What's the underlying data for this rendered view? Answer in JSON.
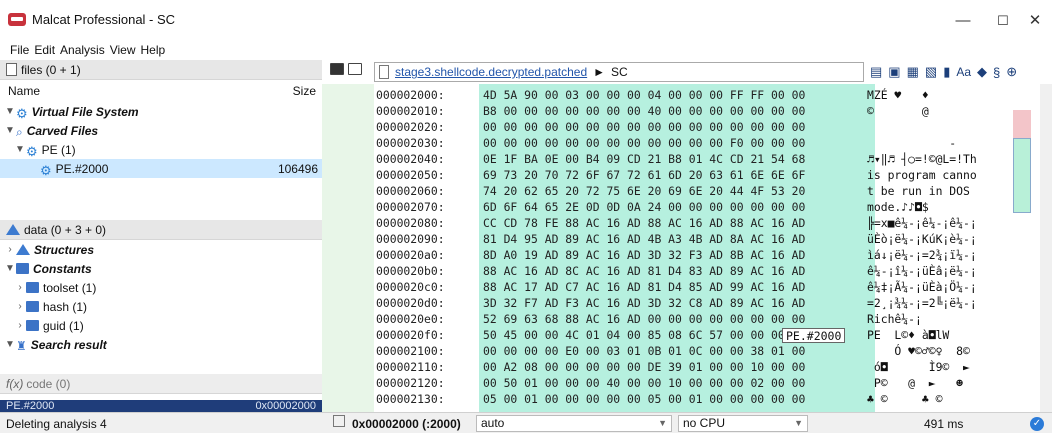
{
  "window": {
    "title": "Malcat Professional - SC",
    "min": "—",
    "max": "☐",
    "close": "✕"
  },
  "menu": [
    "File",
    "Edit",
    "Analysis",
    "View",
    "Help"
  ],
  "files_panel": {
    "header": "files (0 + 1)",
    "col_name": "Name",
    "col_size": "Size",
    "rows": [
      {
        "label": "Virtual File System",
        "size": ""
      },
      {
        "label": "Carved Files",
        "size": ""
      },
      {
        "label": "PE (1)",
        "size": ""
      },
      {
        "label": "PE.#2000",
        "size": "106496"
      }
    ]
  },
  "data_panel": {
    "header": "data (0 + 3 + 0)",
    "rows": [
      {
        "label": "Structures"
      },
      {
        "label": "Constants"
      },
      {
        "label": "toolset (1)"
      },
      {
        "label": "hash (1)"
      },
      {
        "label": "guid (1)"
      },
      {
        "label": "Search result"
      }
    ]
  },
  "code_panel": {
    "header": "code (0)",
    "sel_left": "PE.#2000",
    "sel_right": "0x00002000"
  },
  "path": {
    "file": "stage3.shellcode.decrypted.patched",
    "arrow": "►",
    "node": "SC"
  },
  "hex_rows": [
    {
      "addr": "000002000:",
      "hex": "4D 5A 90 00 03 00 00 00 04 00 00 00 FF FF 00 00",
      "ascii": "MZÉ ♥   ♦"
    },
    {
      "addr": "000002010:",
      "hex": "B8 00 00 00 00 00 00 00 40 00 00 00 00 00 00 00",
      "ascii": "©       @"
    },
    {
      "addr": "000002020:",
      "hex": "00 00 00 00 00 00 00 00 00 00 00 00 00 00 00 00",
      "ascii": ""
    },
    {
      "addr": "000002030:",
      "hex": "00 00 00 00 00 00 00 00 00 00 00 00 F0 00 00 00",
      "ascii": "            -"
    },
    {
      "addr": "000002040:",
      "hex": "0E 1F BA 0E 00 B4 09 CD 21 B8 01 4C CD 21 54 68",
      "ascii": "♬▾‖♬ ┤○=!©@L=!Th"
    },
    {
      "addr": "000002050:",
      "hex": "69 73 20 70 72 6F 67 72 61 6D 20 63 61 6E 6E 6F",
      "ascii": "is program canno"
    },
    {
      "addr": "000002060:",
      "hex": "74 20 62 65 20 72 75 6E 20 69 6E 20 44 4F 53 20",
      "ascii": "t be run in DOS"
    },
    {
      "addr": "000002070:",
      "hex": "6D 6F 64 65 2E 0D 0D 0A 24 00 00 00 00 00 00 00",
      "ascii": "mode.♪♪◘$"
    },
    {
      "addr": "000002080:",
      "hex": "CC CD 78 FE 88 AC 16 AD 88 AC 16 AD 88 AC 16 AD",
      "ascii": "╠=x■ê¼-¡ê¼-¡ê¼-¡"
    },
    {
      "addr": "000002090:",
      "hex": "81 D4 95 AD 89 AC 16 AD 4B A3 4B AD 8A AC 16 AD",
      "ascii": "üÈò¡ë¼-¡KúK¡è¼-¡"
    },
    {
      "addr": "0000020a0:",
      "hex": "8D A0 19 AD 89 AC 16 AD 3D 32 F3 AD 8B AC 16 AD",
      "ascii": "ìá↓¡ë¼-¡=2¾¡ï¼-¡"
    },
    {
      "addr": "0000020b0:",
      "hex": "88 AC 16 AD 8C AC 16 AD 81 D4 83 AD 89 AC 16 AD",
      "ascii": "ê¼-¡î¼-¡üÈâ¡ë¼-¡"
    },
    {
      "addr": "0000020c0:",
      "hex": "88 AC 17 AD C7 AC 16 AD 81 D4 85 AD 99 AC 16 AD",
      "ascii": "ê¼‡¡Ã¼-¡üÈà¡Ö¼-¡"
    },
    {
      "addr": "0000020d0:",
      "hex": "3D 32 F7 AD F3 AC 16 AD 3D 32 C8 AD 89 AC 16 AD",
      "ascii": "=2¸¡¾¼-¡=2╚¡ë¼-¡"
    },
    {
      "addr": "0000020e0:",
      "hex": "52 69 63 68 88 AC 16 AD 00 00 00 00 00 00 00 00",
      "ascii": "Richê¼-¡"
    },
    {
      "addr": "0000020f0:",
      "hex": "50 45 00 00 4C 01 04 00 85 08 6C 57 00 00 00 00",
      "ascii": "PE  L©♦ à◘lW"
    },
    {
      "addr": "000002100:",
      "hex": "00 00 00 00 E0 00 03 01 0B 01 0C 00 00 38 01 00",
      "ascii": "    Ó ♥©♂©♀  8©"
    },
    {
      "addr": "000002110:",
      "hex": "00 A2 08 00 00 00 00 00 DE 39 01 00 00 10 00 00",
      "ascii": " ó◘      Ì9©  ►"
    },
    {
      "addr": "000002120:",
      "hex": "00 50 01 00 00 00 40 00 00 10 00 00 00 02 00 00",
      "ascii": " P©   @  ►   ☻"
    },
    {
      "addr": "000002130:",
      "hex": "05 00 01 00 00 00 00 00 05 00 01 00 00 00 00 00",
      "ascii": "♣ ©     ♣ ©"
    }
  ],
  "tooltip": "PE.#2000",
  "status": {
    "message": "Deleting analysis 4",
    "address": "0x00002000 (:2000)",
    "mode": "auto",
    "cpu": "no CPU",
    "time": "491 ms"
  },
  "colors": {
    "hex_bg": "#b6f0df",
    "selection": "#cce8ff",
    "link": "#2255aa"
  }
}
